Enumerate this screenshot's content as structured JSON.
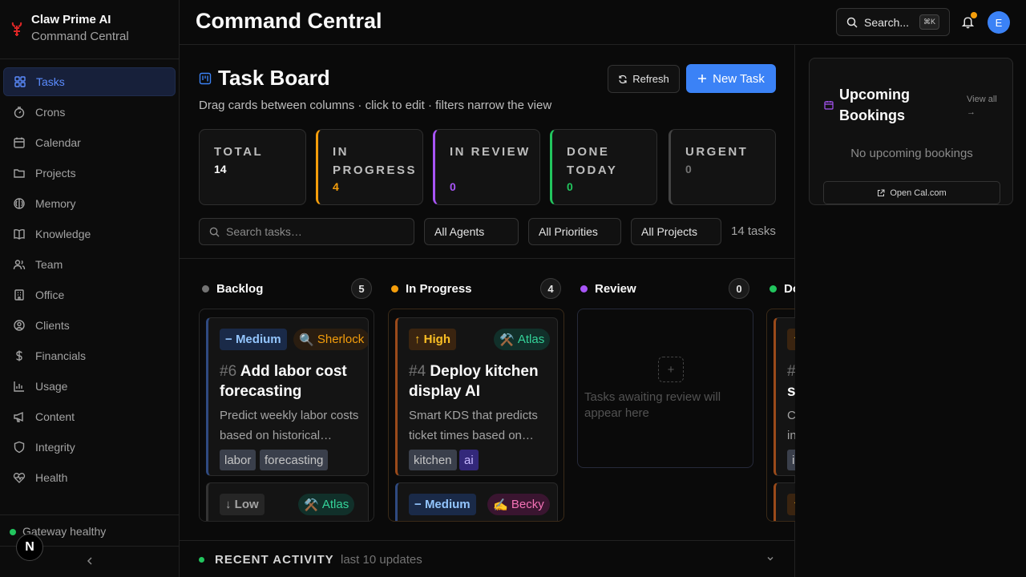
{
  "brand": {
    "name": "Claw Prime AI",
    "subtitle": "Command Central"
  },
  "sidebar": {
    "items": [
      {
        "label": "Tasks",
        "icon": "grid-icon",
        "active": true
      },
      {
        "label": "Crons",
        "icon": "timer-icon"
      },
      {
        "label": "Calendar",
        "icon": "calendar-icon"
      },
      {
        "label": "Projects",
        "icon": "folder-icon"
      },
      {
        "label": "Memory",
        "icon": "brain-icon"
      },
      {
        "label": "Knowledge",
        "icon": "book-icon"
      },
      {
        "label": "Team",
        "icon": "users-icon"
      },
      {
        "label": "Office",
        "icon": "building-icon"
      },
      {
        "label": "Clients",
        "icon": "user-circle-icon"
      },
      {
        "label": "Financials",
        "icon": "dollar-icon"
      },
      {
        "label": "Usage",
        "icon": "bar-chart-icon"
      },
      {
        "label": "Content",
        "icon": "megaphone-icon"
      },
      {
        "label": "Integrity",
        "icon": "shield-icon"
      },
      {
        "label": "Health",
        "icon": "heart-pulse-icon"
      }
    ],
    "gateway_status": "Gateway healthy",
    "badge_letter": "N"
  },
  "header": {
    "title": "Command Central",
    "search_label": "Search...",
    "search_shortcut": "⌘K",
    "avatar_letter": "E",
    "accent": "#3b82f6"
  },
  "board": {
    "title": "Task Board",
    "subtitle": "Drag cards between columns · click to edit · filters narrow the view",
    "refresh_label": "Refresh",
    "new_task_label": "New Task"
  },
  "stats": [
    {
      "label": "TOTAL",
      "value": "14",
      "color": "#fafafa"
    },
    {
      "label": "IN PROGRESS",
      "value": "4",
      "color": "#f59e0b"
    },
    {
      "label": "IN REVIEW",
      "value": "0",
      "color": "#a855f7"
    },
    {
      "label": "DONE TODAY",
      "value": "0",
      "color": "#22c55e"
    },
    {
      "label": "URGENT",
      "value": "0",
      "color": "#737373"
    }
  ],
  "filters": {
    "search_placeholder": "Search tasks…",
    "agent": "All Agents",
    "priority": "All Priorities",
    "project": "All Projects",
    "count": "14 tasks"
  },
  "columns": [
    {
      "title": "Backlog",
      "count": "5",
      "color": "#737373",
      "cards": [
        {
          "priority": "Medium",
          "priority_glyph": "−",
          "agent": "Sherlock",
          "agent_glyph": "🔍",
          "number": "#6",
          "title": "Add labor cost forecasting",
          "desc": "Predict weekly labor costs based on historical…",
          "tags": [
            "labor",
            "forecasting"
          ]
        },
        {
          "priority": "Low",
          "priority_glyph": "↓",
          "agent": "Atlas",
          "agent_glyph": "⚒️"
        }
      ]
    },
    {
      "title": "In Progress",
      "count": "4",
      "color": "#f59e0b",
      "cards": [
        {
          "priority": "High",
          "priority_glyph": "↑",
          "agent": "Atlas",
          "agent_glyph": "⚒️",
          "number": "#4",
          "title": "Deploy kitchen display AI",
          "desc": "Smart KDS that predicts ticket times based on…",
          "tags": [
            "kitchen",
            "ai"
          ]
        },
        {
          "priority": "Medium",
          "priority_glyph": "−",
          "agent": "Becky",
          "agent_glyph": "✍️"
        }
      ]
    },
    {
      "title": "Review",
      "count": "0",
      "color": "#a855f7",
      "empty_plus": "+",
      "empty_text": "Tasks awaiting review will appear here"
    },
    {
      "title": "Do",
      "color": "#22c55e",
      "cards": [
        {
          "priority_glyph": "↑",
          "number": "#",
          "title": "s",
          "desc": "C",
          "desc2": "in",
          "tags": [
            "in"
          ]
        },
        {
          "priority_glyph": "↑"
        }
      ]
    }
  ],
  "activity": {
    "title": "RECENT ACTIVITY",
    "subtitle": "last 10 updates"
  },
  "bookings": {
    "title": "Upcoming Bookings",
    "view_all": "View all →",
    "empty": "No upcoming bookings",
    "open_label": "Open Cal.com"
  }
}
